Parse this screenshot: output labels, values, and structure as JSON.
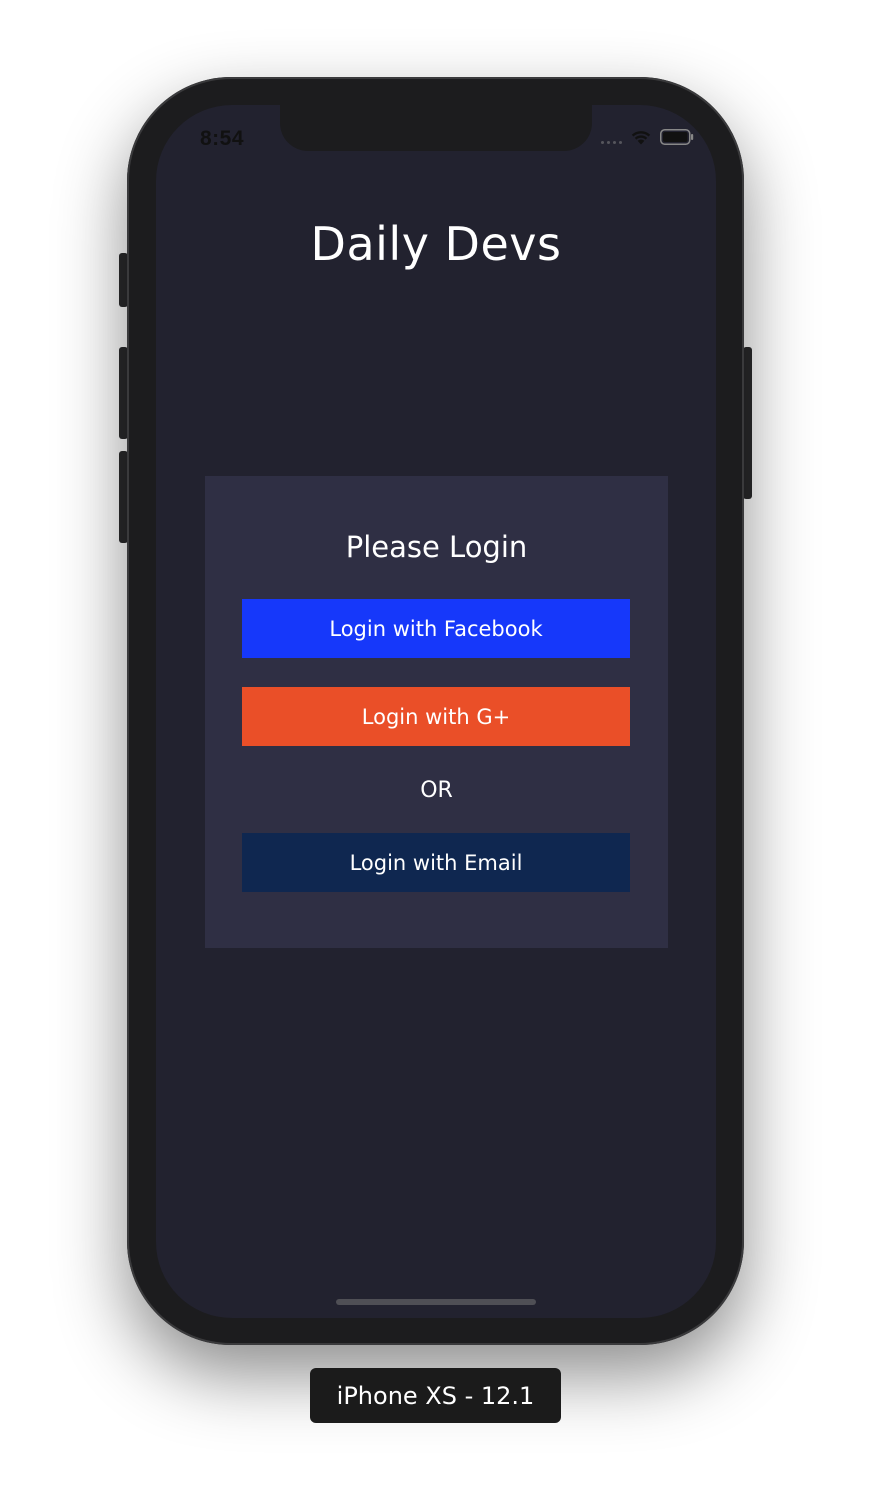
{
  "status_bar": {
    "time": "8:54",
    "icons": [
      "cellular-dots-icon",
      "wifi-icon",
      "battery-icon"
    ]
  },
  "app": {
    "title": "Daily Devs"
  },
  "login_card": {
    "heading": "Please Login",
    "facebook_label": "Login with Facebook",
    "gplus_label": "Login with G+",
    "or_label": "OR",
    "email_label": "Login with Email"
  },
  "colors": {
    "screen_bg": "#22222f",
    "card_bg": "#2f2f44",
    "facebook": "#1638fa",
    "gplus": "#ea4f28",
    "email": "#0f2750"
  },
  "device": {
    "label": "iPhone XS - 12.1"
  }
}
